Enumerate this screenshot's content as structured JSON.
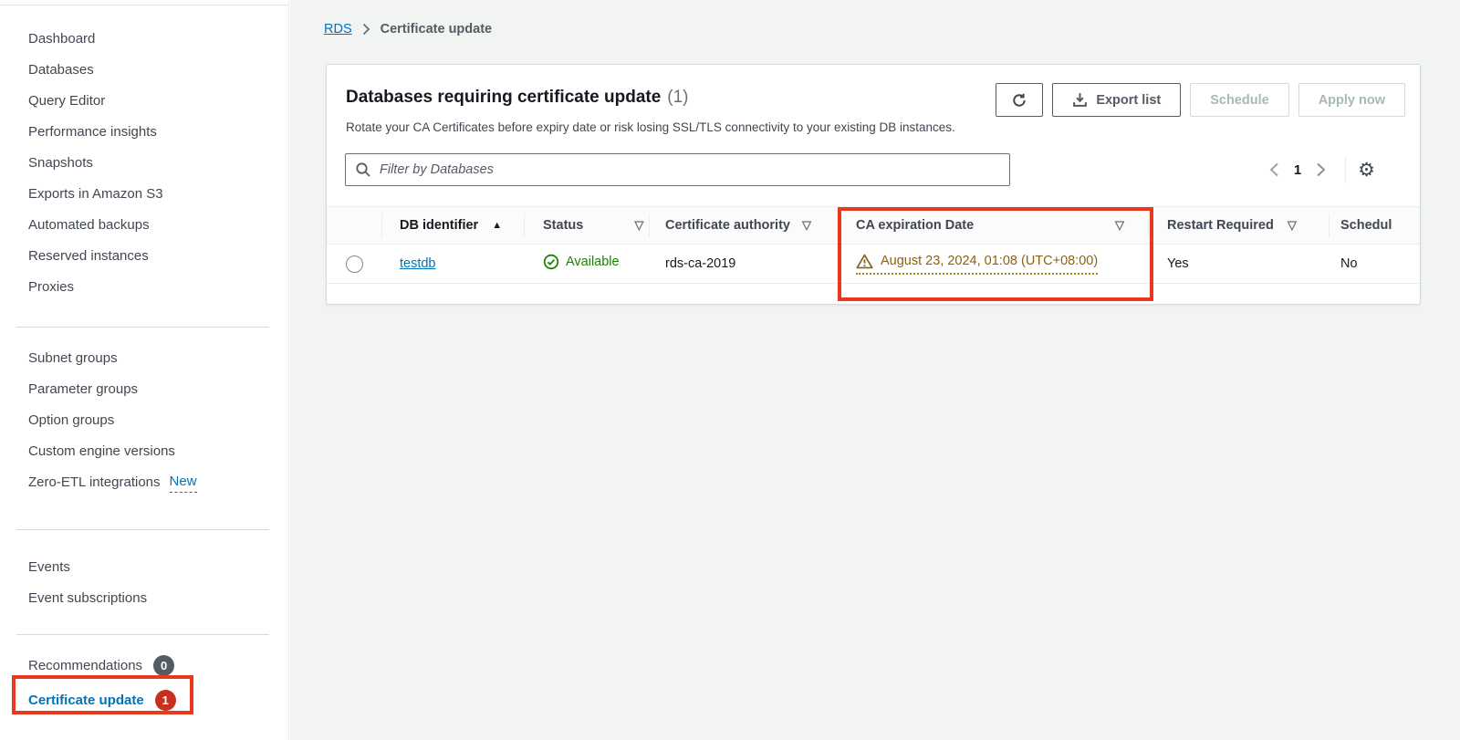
{
  "sidebar": {
    "group1": [
      "Dashboard",
      "Databases",
      "Query Editor",
      "Performance insights",
      "Snapshots",
      "Exports in Amazon S3",
      "Automated backups",
      "Reserved instances",
      "Proxies"
    ],
    "group2": [
      "Subnet groups",
      "Parameter groups",
      "Option groups",
      "Custom engine versions"
    ],
    "zero_etl": {
      "label": "Zero-ETL integrations",
      "badge": "New"
    },
    "group3": [
      "Events",
      "Event subscriptions"
    ],
    "recommendations": {
      "label": "Recommendations",
      "count": "0"
    },
    "certificate_update": {
      "label": "Certificate update",
      "count": "1"
    }
  },
  "breadcrumb": {
    "root": "RDS",
    "current": "Certificate update"
  },
  "panel": {
    "title": "Databases requiring certificate update",
    "count": "(1)",
    "description": "Rotate your CA Certificates before expiry date or risk losing SSL/TLS connectivity to your existing DB instances.",
    "export_button": "Export list",
    "schedule_button": "Schedule",
    "apply_button": "Apply now",
    "filter_placeholder": "Filter by Databases",
    "pagination": {
      "page": "1"
    }
  },
  "table": {
    "headers": {
      "db": "DB identifier",
      "status": "Status",
      "ca": "Certificate authority",
      "expiration": "CA expiration Date",
      "restart": "Restart Required",
      "scheduled": "Schedul"
    },
    "rows": [
      {
        "db": "testdb",
        "status": "Available",
        "ca": "rds-ca-2019",
        "expiration": "August 23, 2024, 01:08 (UTC+08:00)",
        "restart": "Yes",
        "scheduled": "No"
      }
    ]
  },
  "colors": {
    "link_blue": "#0073bb",
    "annotation_red": "#e8391f",
    "badge_red": "#c7301c",
    "badge_gray": "#545b64",
    "warning_text": "#8a6116",
    "success_green": "#1d8102"
  }
}
